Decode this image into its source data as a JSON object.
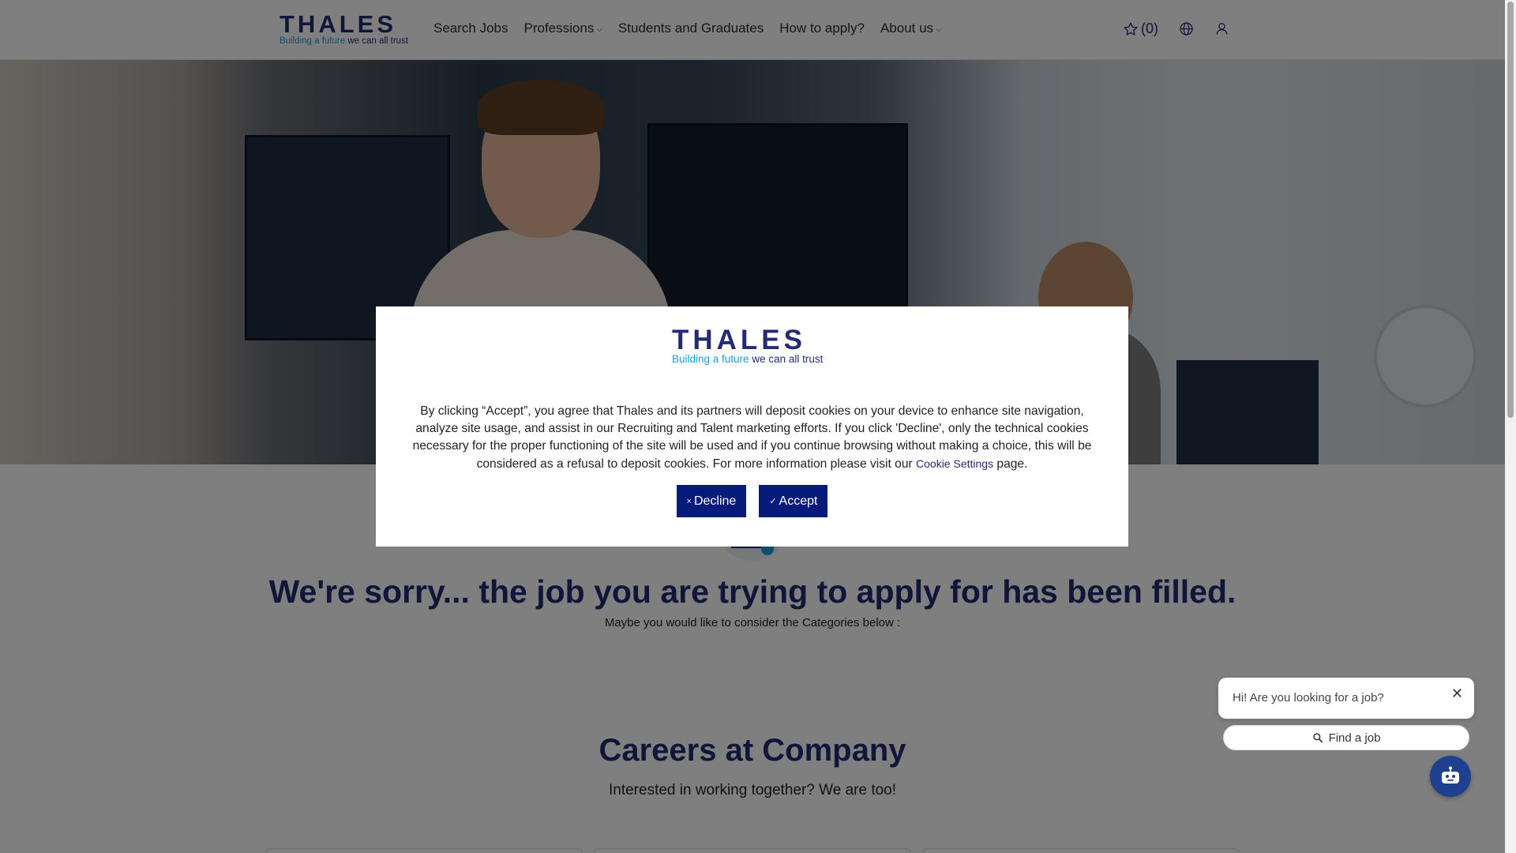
{
  "brand": {
    "word": "THALES",
    "tagline_accent": "Building a future",
    "tagline_rest": " we can all trust"
  },
  "nav": {
    "items": [
      {
        "label": "Search Jobs",
        "dropdown": false
      },
      {
        "label": "Professions",
        "dropdown": true
      },
      {
        "label": "Students and Graduates",
        "dropdown": false
      },
      {
        "label": "How to apply?",
        "dropdown": false
      },
      {
        "label": "About us",
        "dropdown": true
      }
    ],
    "favorites_count": "(0)",
    "icons": [
      "star-icon",
      "globe-icon",
      "user-icon"
    ]
  },
  "main": {
    "sorry_heading": "We're sorry... the job you are trying to apply for has been filled.",
    "maybe_text": "Maybe you would like to consider the Categories below :",
    "careers_heading": "Careers at Company",
    "together_text": "Interested in working together? We are too!"
  },
  "cookie_modal": {
    "text_before_link": "By clicking “Accept”, you agree that Thales and its partners will deposit cookies on your device to enhance site navigation, analyze site usage, and assist in our Recruiting and Talent marketing efforts. If you click 'Decline', only the technical cookies necessary for the proper functioning of the site will be used and if you continue browsing without making a choice, this will be considered as a refusal to deposit cookies. For more information please visit our ",
    "link_text": "Cookie Settings",
    "text_after_link": " page.",
    "decline_mark": "×",
    "decline_label": "Decline",
    "accept_mark": "✓",
    "accept_label": "Accept"
  },
  "chat": {
    "greeting": "Hi! Are you looking for a job?",
    "close_glyph": "✕",
    "find_job_label": "Find a job"
  },
  "colors": {
    "brand_navy": "#242a75",
    "brand_accent": "#1e9ed8",
    "button_blue": "#061a7a",
    "bot_blue": "#1f3f8f"
  }
}
